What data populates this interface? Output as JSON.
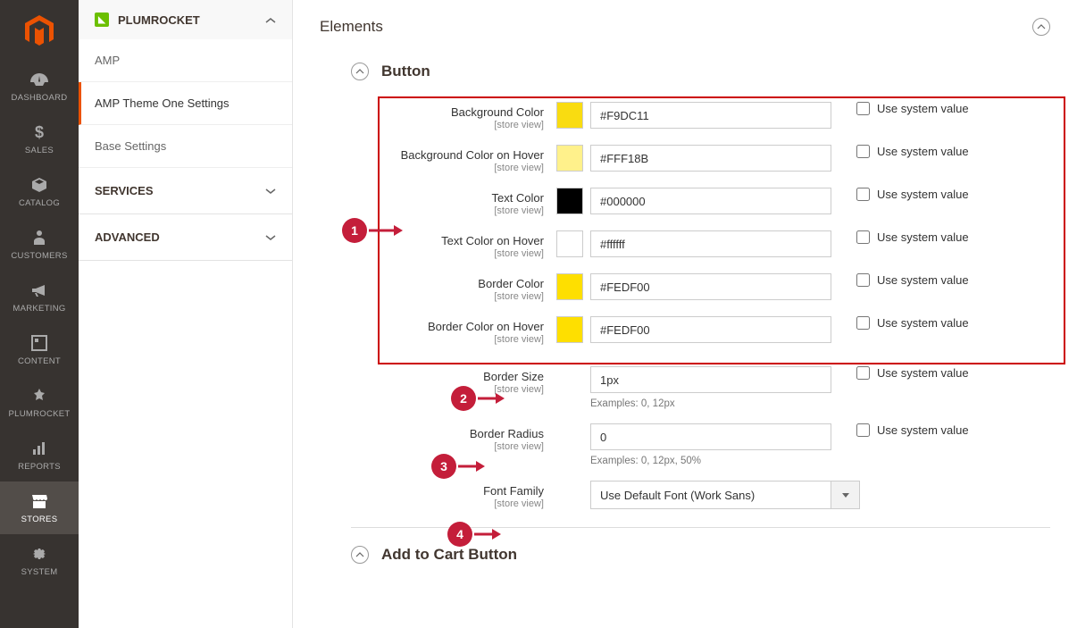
{
  "sidebar": {
    "items": [
      {
        "label": "DASHBOARD"
      },
      {
        "label": "SALES"
      },
      {
        "label": "CATALOG"
      },
      {
        "label": "CUSTOMERS"
      },
      {
        "label": "MARKETING"
      },
      {
        "label": "CONTENT"
      },
      {
        "label": "PLUMROCKET"
      },
      {
        "label": "REPORTS"
      },
      {
        "label": "STORES"
      },
      {
        "label": "SYSTEM"
      }
    ]
  },
  "confignav": {
    "plumrocket": {
      "label": "PLUMROCKET"
    },
    "items": [
      {
        "label": "AMP"
      },
      {
        "label": "AMP Theme One Settings"
      },
      {
        "label": "Base Settings"
      }
    ],
    "services": {
      "label": "SERVICES"
    },
    "advanced": {
      "label": "ADVANCED"
    }
  },
  "main": {
    "section_title": "Elements",
    "button_section": "Button",
    "addtocart_section": "Add to Cart Button",
    "store_view": "[store view]",
    "use_system": "Use system value",
    "fields": {
      "bg_color": {
        "label": "Background Color",
        "value": "#F9DC11",
        "swatch": "#F9DC11"
      },
      "bg_hover": {
        "label": "Background Color on Hover",
        "value": "#FFF18B",
        "swatch": "#FFF18B"
      },
      "text_color": {
        "label": "Text Color",
        "value": "#000000",
        "swatch": "#000000"
      },
      "text_hover": {
        "label": "Text Color on Hover",
        "value": "#ffffff",
        "swatch": "#ffffff"
      },
      "border_color": {
        "label": "Border Color",
        "value": "#FEDF00",
        "swatch": "#FEDF00"
      },
      "border_hover": {
        "label": "Border Color on Hover",
        "value": "#FEDF00",
        "swatch": "#FEDF00"
      },
      "border_size": {
        "label": "Border Size",
        "value": "1px",
        "hint": "Examples: 0, 12px"
      },
      "border_radius": {
        "label": "Border Radius",
        "value": "0",
        "hint": "Examples: 0, 12px, 50%"
      },
      "font_family": {
        "label": "Font Family",
        "value": "Use Default Font (Work Sans)"
      }
    },
    "bubbles": {
      "1": "1",
      "2": "2",
      "3": "3",
      "4": "4"
    }
  }
}
